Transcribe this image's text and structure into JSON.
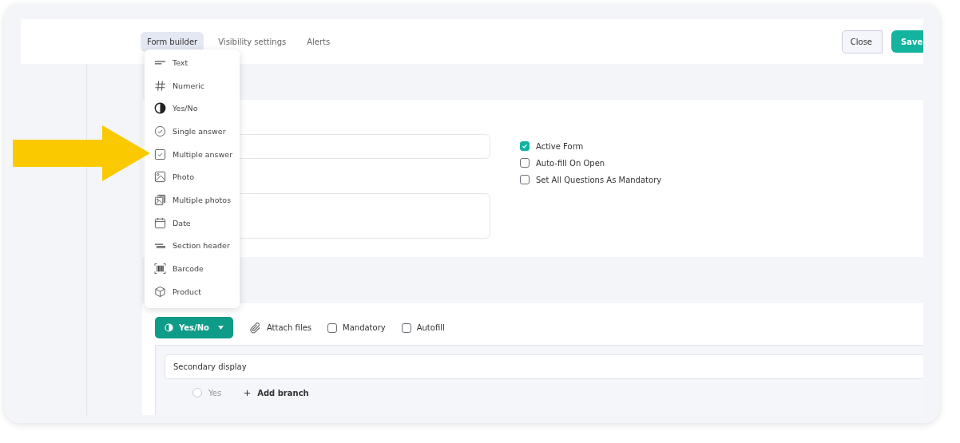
{
  "tabs": [
    {
      "label": "Form builder",
      "selected": true
    },
    {
      "label": "Visibility settings",
      "selected": false
    },
    {
      "label": "Alerts",
      "selected": false
    }
  ],
  "actions": [
    {
      "label": "Close",
      "kind": "secondary"
    },
    {
      "label": "Save",
      "kind": "primary"
    }
  ],
  "field_type_menu": [
    {
      "label": "Text",
      "kind": "text"
    },
    {
      "label": "Numeric",
      "kind": "numeric"
    },
    {
      "label": "Yes/No",
      "kind": "yesno"
    },
    {
      "label": "Single answer",
      "kind": "single"
    },
    {
      "label": "Multiple answer",
      "kind": "multiple"
    },
    {
      "label": "Photo",
      "kind": "photo"
    },
    {
      "label": "Multiple photos",
      "kind": "photos"
    },
    {
      "label": "Date",
      "kind": "date"
    },
    {
      "label": "Section header",
      "kind": "section"
    },
    {
      "label": "Barcode",
      "kind": "barcode"
    },
    {
      "label": "Product",
      "kind": "product"
    }
  ],
  "form_options": [
    {
      "label": "Active Form",
      "checked": true
    },
    {
      "label": "Auto-fill On Open",
      "checked": false
    },
    {
      "label": "Set All Questions As Mandatory",
      "checked": false
    }
  ],
  "question": {
    "type_button": {
      "label": "Yes/No",
      "kind": "yesno"
    },
    "attach": "Attach files",
    "options": [
      {
        "label": "Mandatory",
        "checked": false
      },
      {
        "label": "Autofill",
        "checked": false
      }
    ],
    "secondary_display": "Secondary display",
    "branch_option": {
      "label": "Yes",
      "selected": false
    },
    "add_branch": "Add branch"
  }
}
